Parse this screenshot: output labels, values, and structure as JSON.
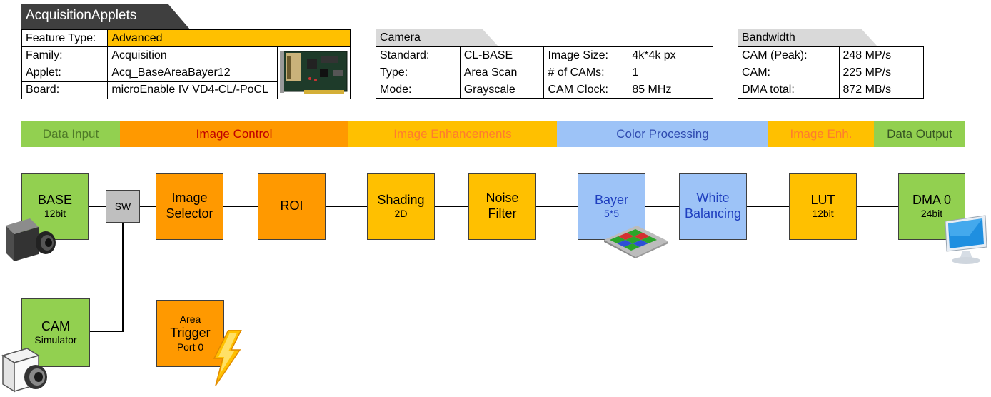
{
  "header": {
    "title": "AcquisitionApplets"
  },
  "feature": {
    "type_label": "Feature Type:",
    "type_value": "Advanced",
    "rows": [
      {
        "label": "Family:",
        "value": "Acquisition"
      },
      {
        "label": "Applet:",
        "value": "Acq_BaseAreaBayer12"
      },
      {
        "label": "Board:",
        "value": "microEnable IV VD4-CL/-PoCL"
      }
    ]
  },
  "camera": {
    "title": "Camera",
    "rows": [
      {
        "label1": "Standard:",
        "value1": "CL-BASE",
        "label2": "Image Size:",
        "value2": "4k*4k px"
      },
      {
        "label1": "Type:",
        "value1": "Area Scan",
        "label2": "# of CAMs:",
        "value2": "1"
      },
      {
        "label1": "Mode:",
        "value1": "Grayscale",
        "label2": "CAM Clock:",
        "value2": "85 MHz"
      }
    ]
  },
  "bandwidth": {
    "title": "Bandwidth",
    "rows": [
      {
        "label": "CAM (Peak):",
        "value": "248 MP/s"
      },
      {
        "label": "CAM:",
        "value": "225 MP/s"
      },
      {
        "label": "DMA total:",
        "value": "872 MB/s"
      }
    ]
  },
  "categories": [
    {
      "label": "Data Input",
      "bg": "#92d050",
      "fg": "#4f7a28"
    },
    {
      "label": "Image Control",
      "bg": "#ff9900",
      "fg": "#c00000"
    },
    {
      "label": "Image Enhancements",
      "bg": "#ffc000",
      "fg": "#ff7b2e"
    },
    {
      "label": "Color Processing",
      "bg": "#9dc3f7",
      "fg": "#2f4bb0"
    },
    {
      "label": "Image Enh.",
      "bg": "#ffc000",
      "fg": "#ff7b2e"
    },
    {
      "label": "Data Output",
      "bg": "#92d050",
      "fg": "#375623"
    }
  ],
  "blocks": {
    "base": {
      "title": "BASE",
      "sub": "12bit"
    },
    "sw": {
      "title": "SW"
    },
    "image_selector": {
      "title": "Image",
      "title2": "Selector"
    },
    "roi": {
      "title": "ROI"
    },
    "shading": {
      "title": "Shading",
      "sub": "2D"
    },
    "noise": {
      "title": "Noise",
      "title2": "Filter"
    },
    "bayer": {
      "title": "Bayer",
      "sub": "5*5"
    },
    "white": {
      "title": "White",
      "title2": "Balancing"
    },
    "lut": {
      "title": "LUT",
      "sub": "12bit"
    },
    "dma": {
      "title": "DMA 0",
      "sub": "24bit"
    },
    "cam_sim": {
      "title": "CAM",
      "sub": "Simulator"
    },
    "trigger": {
      "pre": "Area",
      "title": "Trigger",
      "sub": "Port 0"
    }
  },
  "icons": [
    "board-image",
    "camera-icon",
    "bayer-grid-icon",
    "monitor-icon",
    "camera-simulator-icon",
    "lightning-icon"
  ]
}
